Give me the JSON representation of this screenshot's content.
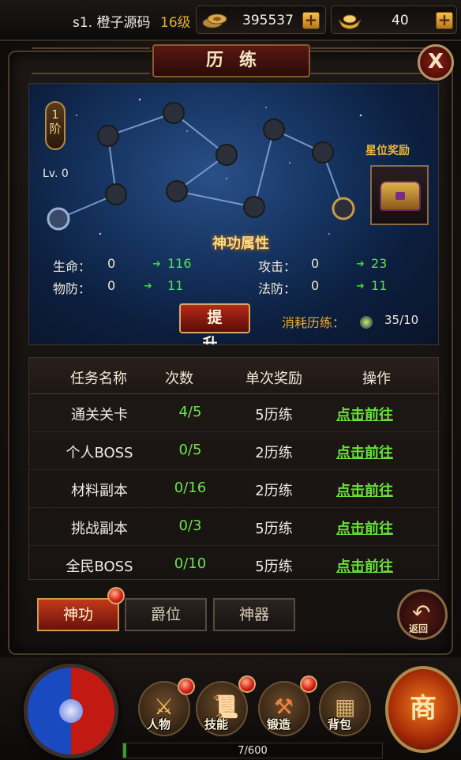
{
  "topbar": {
    "server_name": "s1. 橙子源码",
    "level": "16级",
    "coins": "395537",
    "gold": "40",
    "coin_icon": "coin-stack-icon",
    "gold_icon": "gold-ingot-icon"
  },
  "title": "历练",
  "starmap": {
    "tier": "1\n阶",
    "level": "Lv. 0",
    "reward_label": "星位奖励",
    "attr_title": "神功属性",
    "stats": [
      {
        "label": "生命：",
        "value": "0",
        "next": "116"
      },
      {
        "label": "攻击：",
        "value": "0",
        "next": "23"
      },
      {
        "label": "物防：",
        "value": "0",
        "next": "11"
      },
      {
        "label": "法防：",
        "value": "0",
        "next": "11"
      }
    ],
    "upgrade_label": "提 升",
    "cost_label": "消耗历练：",
    "cost_value": "35/10"
  },
  "tasks": {
    "headers": [
      "任务名称",
      "次数",
      "单次奖励",
      "操作"
    ],
    "rows": [
      {
        "name": "通关关卡",
        "count": "4/5",
        "reward": "5历练",
        "action": "点击前往"
      },
      {
        "name": "个人BOSS",
        "count": "0/5",
        "reward": "2历练",
        "action": "点击前往"
      },
      {
        "name": "材料副本",
        "count": "0/16",
        "reward": "2历练",
        "action": "点击前往"
      },
      {
        "name": "挑战副本",
        "count": "0/3",
        "reward": "5历练",
        "action": "点击前往"
      },
      {
        "name": "全民BOSS",
        "count": "0/10",
        "reward": "5历练",
        "action": "点击前往"
      }
    ]
  },
  "tabs": [
    "神功",
    "爵位",
    "神器"
  ],
  "back_label": "返回",
  "bottom": {
    "buttons": [
      "人物",
      "技能",
      "锻造",
      "背包"
    ],
    "shop": "商",
    "xp_text": "7/600",
    "xp_fraction": 0.0117
  }
}
